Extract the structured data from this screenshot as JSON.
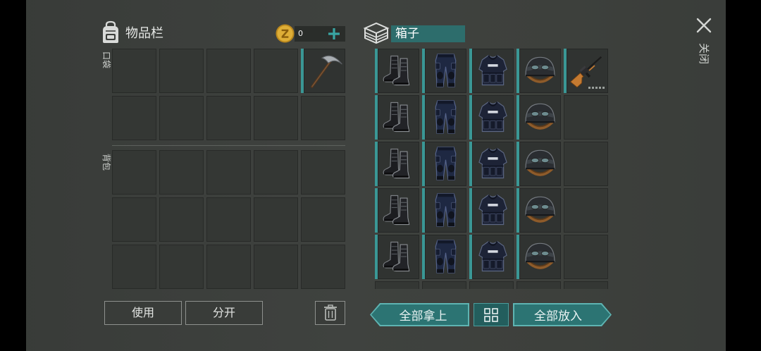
{
  "colors": {
    "accent": "#2c7473",
    "accent_light": "#5eb4b2",
    "accent_dark": "#235e5d",
    "slot_marker": "#3a9795",
    "coin": "#deae37"
  },
  "inventory": {
    "title": "物品栏",
    "icon": "backpack-icon",
    "coins": "0",
    "coin_icon": "coin-icon",
    "add_icon": "plus-icon",
    "pocket_label": "口袋",
    "backpack_label": "背包",
    "pocket_slots": [
      [
        null,
        null,
        null,
        null,
        {
          "icon": "pickaxe-icon"
        }
      ],
      [
        null,
        null,
        null,
        null,
        null
      ]
    ],
    "backpack_slots": [
      [
        null,
        null,
        null,
        null,
        null
      ],
      [
        null,
        null,
        null,
        null,
        null
      ],
      [
        null,
        null,
        null,
        null,
        null
      ]
    ]
  },
  "actions": {
    "use_label": "使用",
    "split_label": "分开",
    "trash_icon": "trash-icon"
  },
  "box": {
    "title": "箱子",
    "icon": "box-icon",
    "slots": [
      [
        {
          "icon": "boots-icon"
        },
        {
          "icon": "pants-icon"
        },
        {
          "icon": "vest-icon"
        },
        {
          "icon": "helmet-icon"
        },
        {
          "icon": "rifle-icon",
          "durability_dots": 5
        }
      ],
      [
        {
          "icon": "boots-icon"
        },
        {
          "icon": "pants-icon"
        },
        {
          "icon": "vest-icon"
        },
        {
          "icon": "helmet-icon"
        },
        null
      ],
      [
        {
          "icon": "boots-icon"
        },
        {
          "icon": "pants-icon"
        },
        {
          "icon": "vest-icon"
        },
        {
          "icon": "helmet-icon"
        },
        null
      ],
      [
        {
          "icon": "boots-icon"
        },
        {
          "icon": "pants-icon"
        },
        {
          "icon": "vest-icon"
        },
        {
          "icon": "helmet-icon"
        },
        null
      ],
      [
        {
          "icon": "boots-icon"
        },
        {
          "icon": "pants-icon"
        },
        {
          "icon": "vest-icon"
        },
        {
          "icon": "helmet-icon"
        },
        null
      ],
      [
        null,
        null,
        null,
        null,
        null
      ]
    ],
    "take_all_label": "全部拿上",
    "sort_icon": "grid-icon",
    "put_all_label": "全部放入"
  },
  "close": {
    "icon": "close-icon",
    "label": "关闭"
  }
}
